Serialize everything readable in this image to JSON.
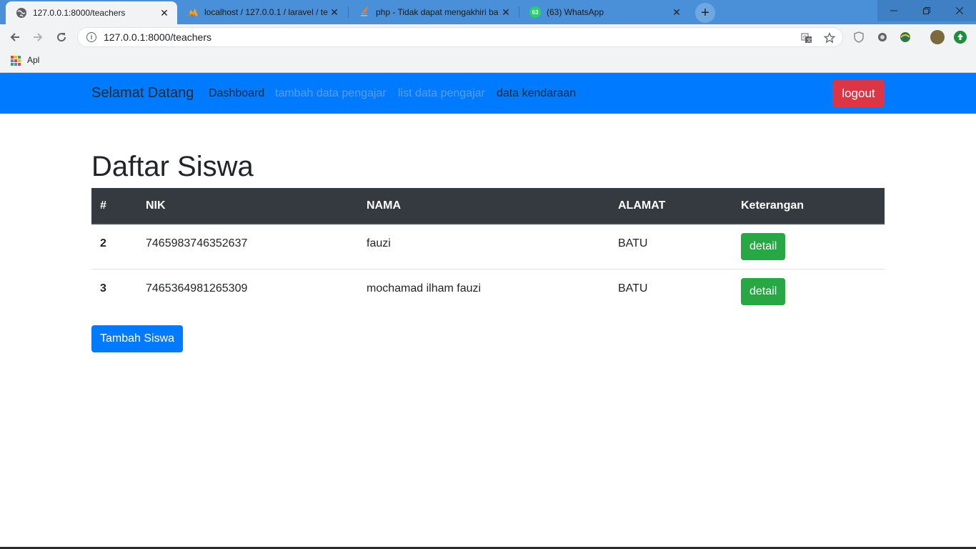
{
  "browser": {
    "tabs": [
      {
        "title": "127.0.0.1:8000/teachers",
        "active": true
      },
      {
        "title": "localhost / 127.0.0.1 / laravel / te",
        "active": false
      },
      {
        "title": "php - Tidak dapat mengakhiri ba",
        "active": false
      },
      {
        "title": "(63) WhatsApp",
        "active": false
      }
    ],
    "whatsapp_badge": "63",
    "address": "127.0.0.1:8000/teachers",
    "bookmarks": {
      "apps_label": "Apl"
    }
  },
  "navbar": {
    "brand": "Selamat Datang",
    "links": [
      {
        "label": "Dashboard",
        "color": "#1d2a3a"
      },
      {
        "label": "tambah data pengajar",
        "color": "#5a9de6"
      },
      {
        "label": "list data pengajar",
        "color": "#5a9de6"
      },
      {
        "label": "data kendaraan",
        "color": "#1d2a3a"
      }
    ],
    "logout_label": "logout"
  },
  "main": {
    "title": "Daftar Siswa",
    "table": {
      "headers": [
        "#",
        "NIK",
        "NAMA",
        "ALAMAT",
        "Keterangan"
      ],
      "rows": [
        {
          "id": "2",
          "nik": "7465983746352637",
          "nama": "fauzi",
          "alamat": "BATU",
          "action": "detail"
        },
        {
          "id": "3",
          "nik": "7465364981265309",
          "nama": "mochamad ilham fauzi",
          "alamat": "BATU",
          "action": "detail"
        }
      ]
    },
    "add_button": "Tambah Siswa"
  },
  "colors": {
    "primary": "#007bff",
    "danger": "#dc3545",
    "success": "#28a745",
    "table_header": "#343a40"
  }
}
